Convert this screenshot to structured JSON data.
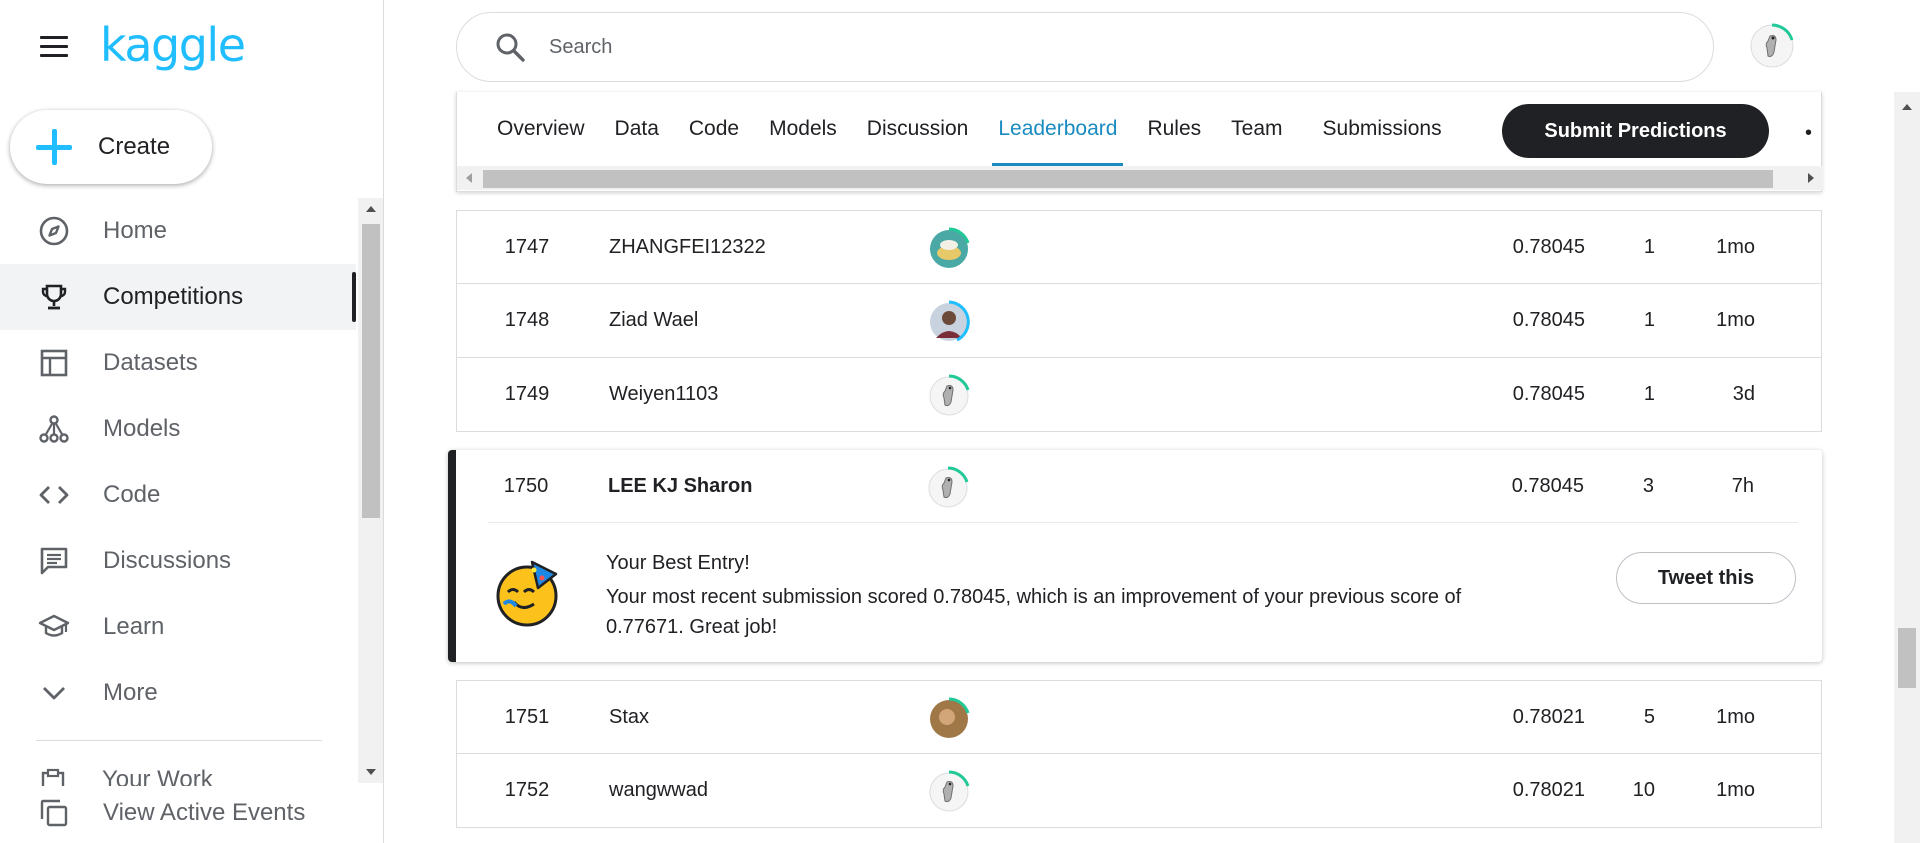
{
  "app": {
    "logo_text": "kaggle",
    "brand_color": "#20beff"
  },
  "sidebar": {
    "create_label": "Create",
    "items": [
      {
        "label": "Home",
        "icon": "compass-icon",
        "active": false
      },
      {
        "label": "Competitions",
        "icon": "trophy-icon",
        "active": true
      },
      {
        "label": "Datasets",
        "icon": "table-icon",
        "active": false
      },
      {
        "label": "Models",
        "icon": "models-icon",
        "active": false
      },
      {
        "label": "Code",
        "icon": "code-icon",
        "active": false
      },
      {
        "label": "Discussions",
        "icon": "comment-icon",
        "active": false
      },
      {
        "label": "Learn",
        "icon": "school-icon",
        "active": false
      },
      {
        "label": "More",
        "icon": "chevron-down-icon",
        "active": false
      }
    ],
    "your_work_label": "Your Work",
    "view_active_events_label": "View Active Events"
  },
  "search": {
    "placeholder": "Search"
  },
  "tabs": {
    "items": [
      "Overview",
      "Data",
      "Code",
      "Models",
      "Discussion",
      "Leaderboard",
      "Rules",
      "Team",
      "Submissions"
    ],
    "active": "Leaderboard",
    "submit_label": "Submit Predictions",
    "more_glyph": "•",
    "accent_color": "#1a8bc1"
  },
  "leaderboard": {
    "rows_before": [
      {
        "rank": "1747",
        "team": "ZHANGFEI12322",
        "avatar": "photo-avatar-icon",
        "score": "0.78045",
        "entries": "1",
        "last": "1mo"
      },
      {
        "rank": "1748",
        "team": "Ziad Wael",
        "avatar": "photo-avatar-icon",
        "score": "0.78045",
        "entries": "1",
        "last": "1mo"
      },
      {
        "rank": "1749",
        "team": "Weiyen1103",
        "avatar": "goose-avatar-icon",
        "score": "0.78045",
        "entries": "1",
        "last": "3d"
      }
    ],
    "highlight": {
      "rank": "1750",
      "team": "LEE KJ Sharon",
      "avatar": "goose-avatar-icon",
      "score": "0.78045",
      "entries": "3",
      "last": "7h",
      "title": "Your Best Entry!",
      "message": "Your most recent submission scored 0.78045, which is an improvement of your previous score of 0.77671. Great job!",
      "tweet_label": "Tweet this"
    },
    "rows_after": [
      {
        "rank": "1751",
        "team": "Stax",
        "avatar": "photo-avatar-icon",
        "score": "0.78021",
        "entries": "5",
        "last": "1mo"
      },
      {
        "rank": "1752",
        "team": "wangwwad",
        "avatar": "goose-avatar-icon",
        "score": "0.78021",
        "entries": "10",
        "last": "1mo"
      }
    ]
  }
}
